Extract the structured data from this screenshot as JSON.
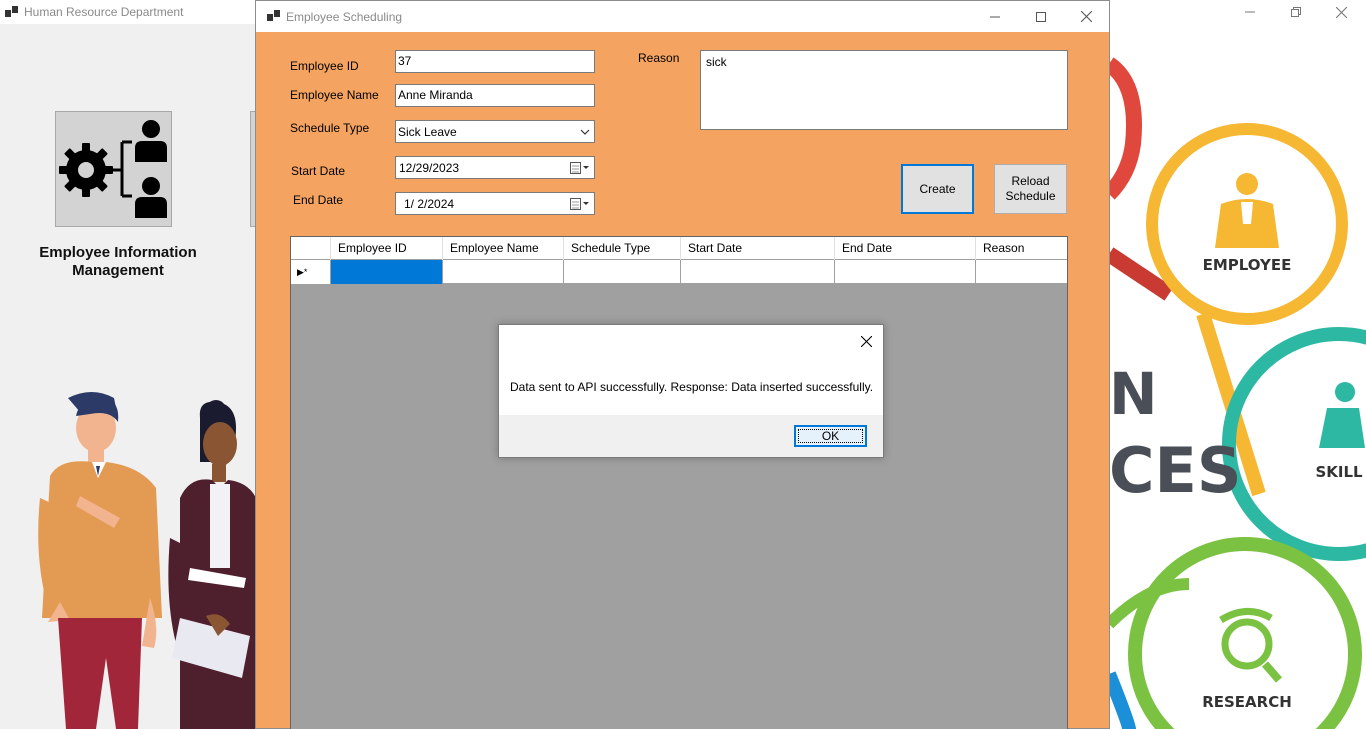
{
  "main_window": {
    "title": "Human Resource Department",
    "controls": [
      "minimize",
      "restore",
      "close"
    ]
  },
  "left_panel": {
    "module_label": "Employee Information Management",
    "tile_icon": "gear-org-chart-icon",
    "illustration": "two-employees-illustration"
  },
  "right_panel": {
    "labels": {
      "employee": "EMPLOYEE",
      "skill": "SKILL",
      "research": "RESEARCH",
      "partial_text_1": "N",
      "partial_text_2": "CES"
    }
  },
  "scheduling_window": {
    "title": "Employee Scheduling",
    "form": {
      "employee_id_label": "Employee ID",
      "employee_id_value": "37",
      "employee_name_label": "Employee Name",
      "employee_name_value": "Anne Miranda",
      "schedule_type_label": "Schedule Type",
      "schedule_type_value": "Sick Leave",
      "start_date_label": "Start Date",
      "start_date_value": "12/29/2023",
      "end_date_label": "End Date",
      "end_date_value": "1/  2/2024",
      "reason_label": "Reason",
      "reason_value": "sick"
    },
    "buttons": {
      "create": "Create",
      "reload": "Reload Schedule"
    },
    "grid": {
      "columns": [
        "Employee ID",
        "Employee Name",
        "Schedule Type",
        "Start Date",
        "End Date",
        "Reason"
      ],
      "rows": [],
      "new_row_indicator": "▶*"
    }
  },
  "message_box": {
    "text": "Data sent to API successfully. Response: Data inserted successfully.",
    "ok_label": "OK"
  },
  "colors": {
    "form_background": "#f4a460",
    "accent": "#0078d7",
    "grid_background": "#a0a0a0"
  }
}
